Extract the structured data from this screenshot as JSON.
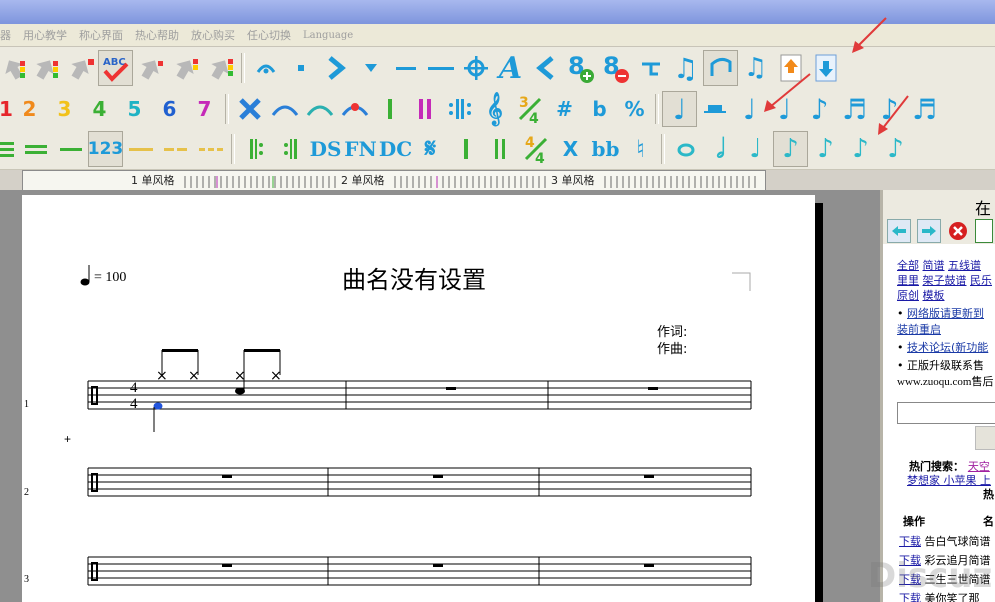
{
  "menubar": {
    "items": [
      "器",
      "用心教学",
      "称心界面",
      "热心帮助",
      "放心购买",
      "任心切换",
      "Language"
    ]
  },
  "ruler": {
    "segments": [
      "1 单风格",
      "2 单风格",
      "3 单风格"
    ]
  },
  "toolbar_row2": {
    "numbers": [
      "1",
      "2",
      "3",
      "4",
      "5",
      "6",
      "7"
    ],
    "symbols": [
      "#",
      "b",
      "%"
    ]
  },
  "toolbar_row3": {
    "labels": [
      "123",
      "DS",
      "FN",
      "DC",
      "X",
      "bb"
    ]
  },
  "score": {
    "tempo_value": "= 100",
    "title": "曲名没有设置",
    "lyricist_label": "作词:",
    "composer_label": "作曲:",
    "time_signature": {
      "top": "4",
      "bottom": "4"
    },
    "system_numbers": [
      "1",
      "2",
      "3"
    ],
    "plus_marker": "+"
  },
  "side_panel": {
    "title_fragment": "在线",
    "links_row1": [
      "全部",
      "简谱",
      "五线谱"
    ],
    "links_row2": [
      "里里",
      "架子鼓谱",
      "民乐"
    ],
    "links_row3": [
      "原创",
      "模板"
    ],
    "bullet1": "网络版请更新到",
    "bullet1_cont": "装前重启",
    "bullet2": "技术论坛(新功能",
    "bullet3": "正版升级联系售",
    "site": "www.zuoqu.com售后",
    "hot_search_label": "热门搜索：",
    "hot_search_term1": "天空",
    "hot_search_line2": "梦想家 小苹果 上",
    "hot_label": "热",
    "col_action": "操作",
    "col_name": "名",
    "rows": [
      {
        "action": "下载",
        "name": "告白气球简谱"
      },
      {
        "action": "下载",
        "name": "彩云追月简谱"
      },
      {
        "action": "下载",
        "name": "三生三世简谱"
      },
      {
        "action": "下载",
        "name": "美你笑了那"
      }
    ]
  },
  "watermark": "Discuz!",
  "colors": {
    "accent_blue": "#1e9ad8",
    "arrow_red": "#e03a3a"
  }
}
